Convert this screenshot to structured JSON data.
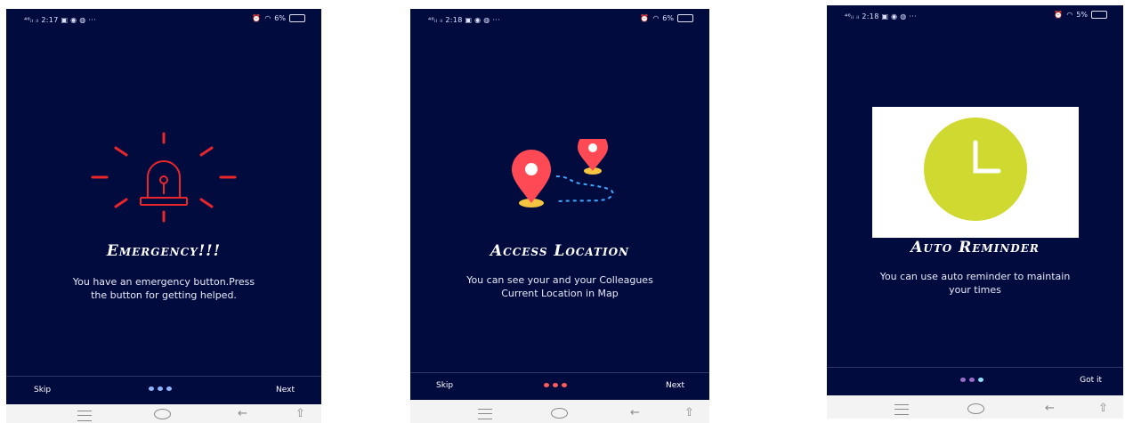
{
  "screens": [
    {
      "status": {
        "time": "2:17",
        "signal": "⁴⁶ᵢₗ ᵢₗ",
        "extras": "···",
        "battery": "6%"
      },
      "title": "Emergency!!!",
      "description_line1": "You have an emergency button.Press",
      "description_line2": "the button for getting helped.",
      "skip_label": "Skip",
      "next_label": "Next",
      "illustration": "alarm-siren-icon",
      "dot_colors": [
        "#8fb4ff",
        "#8fb4ff",
        "#8fb4ff"
      ]
    },
    {
      "status": {
        "time": "2:18",
        "signal": "⁴⁶ᵢₗ ᵢₗ",
        "extras": "···",
        "battery": "6%"
      },
      "title": "Access Location",
      "description_line1": "You can see your and your Colleagues",
      "description_line2": "Current Location in Map",
      "skip_label": "Skip",
      "next_label": "Next",
      "illustration": "map-pins-route-icon",
      "dot_colors": [
        "#ff5a5a",
        "#ff5a5a",
        "#ff5a5a"
      ]
    },
    {
      "status": {
        "time": "2:18",
        "signal": "⁴⁶ᵢₗ ᵢₗ",
        "extras": "···",
        "battery": "5%"
      },
      "title": "Auto Reminder",
      "description_line1": "You can use auto reminder to maintain",
      "description_line2": "your times",
      "got_it_label": "Got it",
      "illustration": "clock-icon",
      "dot_colors": [
        "#9b6cc9",
        "#9b6cc9",
        "#8fe0ff"
      ]
    }
  ],
  "colors": {
    "screen_bg": "#020b3e",
    "siren_red": "#e8262b",
    "pin_red": "#ff4a55",
    "clock_yellow": "#cfd92f",
    "route_blue": "#3ea7ff"
  }
}
